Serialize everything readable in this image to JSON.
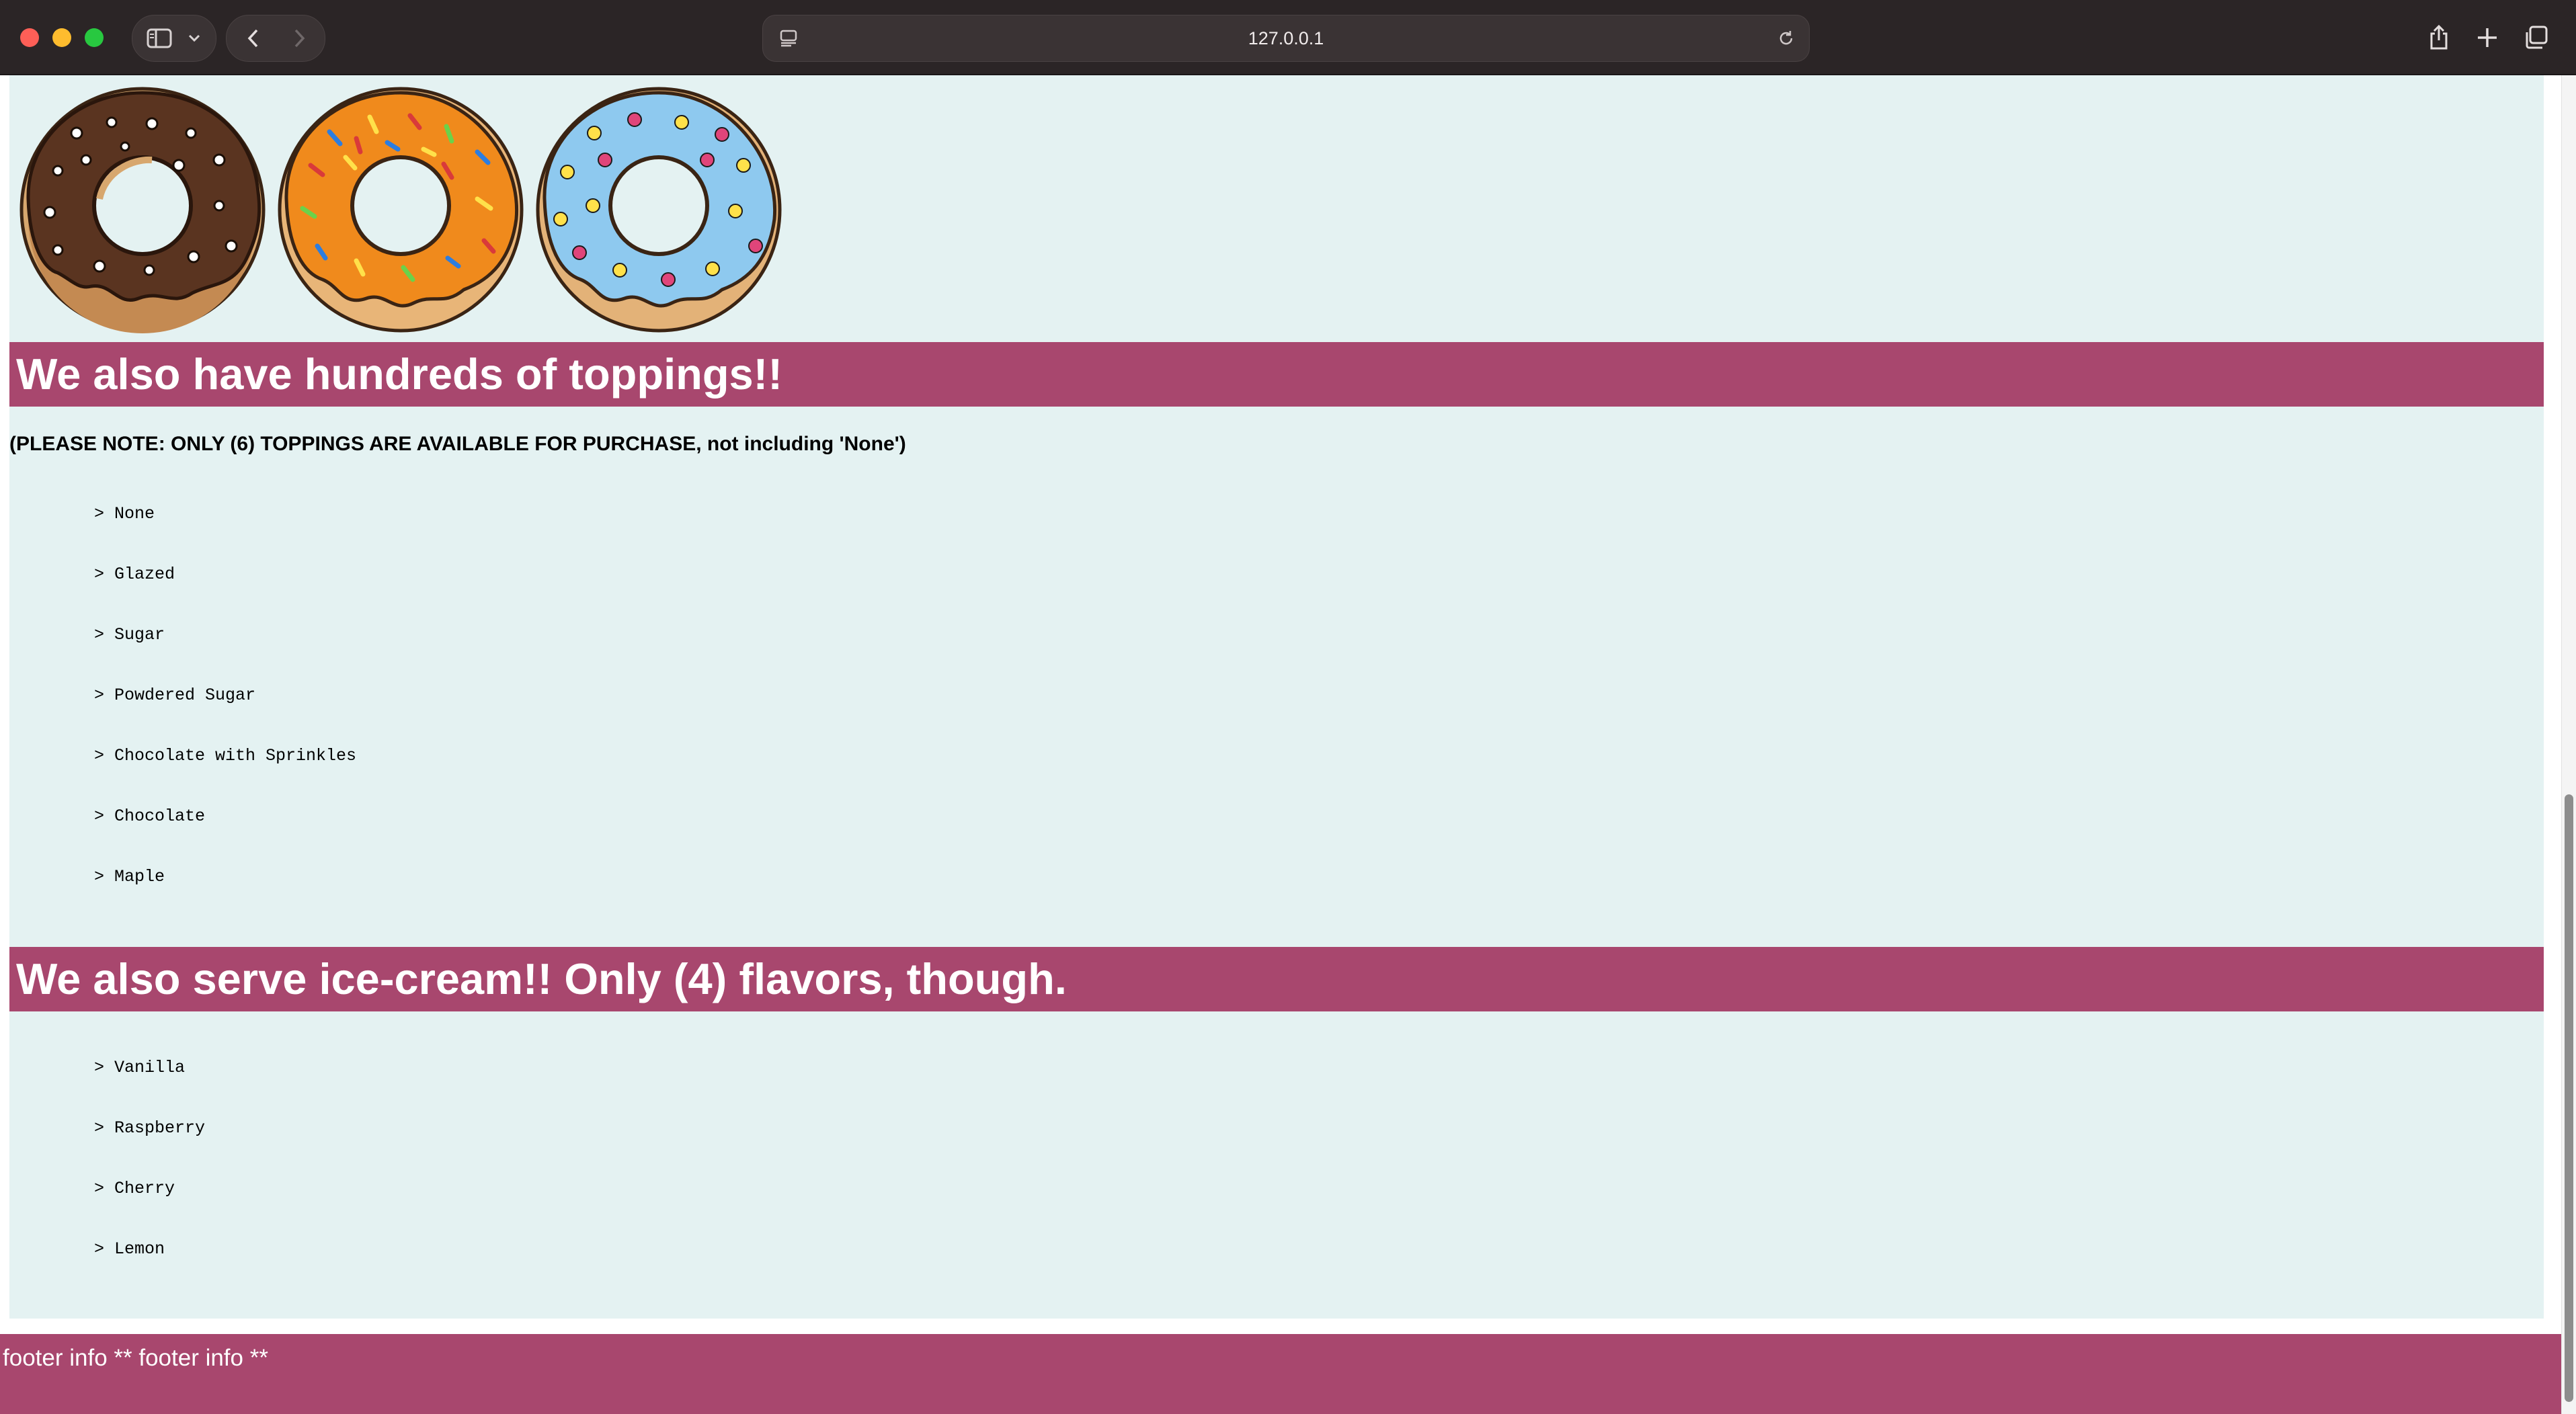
{
  "browser": {
    "url": "127.0.0.1",
    "icons": {
      "sidebar": "sidebar-icon",
      "sidebar_menu": "chevron-down-icon",
      "back": "chevron-left-icon",
      "forward": "chevron-right-icon",
      "site_settings": "page-settings-icon",
      "reload": "reload-icon",
      "share": "share-icon",
      "new_tab": "plus-icon",
      "tab_overview": "tab-overview-icon"
    }
  },
  "toppings": {
    "heading": "We also have hundreds of toppings!!",
    "note": "(PLEASE NOTE: ONLY (6) TOPPINGS ARE AVAILABLE FOR PURCHASE, not including 'None')",
    "items": [
      "> None",
      "> Glazed",
      "> Sugar",
      "> Powdered Sugar",
      "> Chocolate with Sprinkles",
      "> Chocolate",
      "> Maple"
    ]
  },
  "ice_cream": {
    "heading": "We also serve ice-cream!! Only (4) flavors, though.",
    "items": [
      "> Vanilla",
      "> Raspberry",
      "> Cherry",
      "> Lemon"
    ]
  },
  "footer": {
    "text": "footer info ** footer info **"
  },
  "colors": {
    "banner": "#a8476e",
    "panel": "#e4f2f2",
    "chrome": "#2b2526"
  }
}
